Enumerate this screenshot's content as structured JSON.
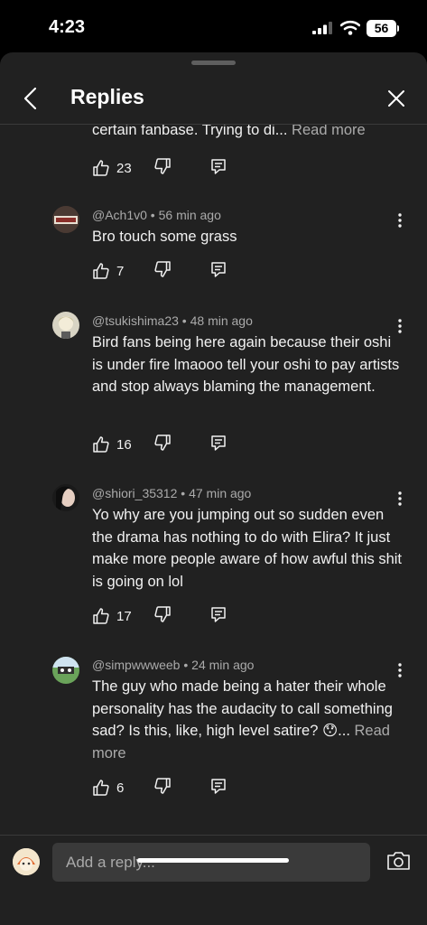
{
  "status_bar": {
    "time": "4:23",
    "battery": "56"
  },
  "header": {
    "title": "Replies"
  },
  "partial_comment": {
    "text": "certain fanbase. Trying to di...",
    "read_more": "Read more",
    "likes": "23"
  },
  "comments": [
    {
      "handle": "@Ach1v0",
      "time": "56 min ago",
      "text": "Bro touch some grass",
      "read_more": "",
      "likes": "7"
    },
    {
      "handle": "@tsukishima23",
      "time": "48 min ago",
      "text": "Bird fans being here again because their oshi is under fire lmaooo tell your oshi to pay artists and stop always blaming the management.",
      "read_more": "",
      "likes": "16"
    },
    {
      "handle": "@shiori_35312",
      "time": "47 min ago",
      "text": "Yo why are you jumping out so sudden even the drama has nothing to do with Elira? It just make more people aware of how awful this shit is going on lol",
      "read_more": "",
      "likes": "17"
    },
    {
      "handle": "@simpwwweeb",
      "time": "24 min ago",
      "text": "The guy who made being a hater their whole personality has the audacity to call something sad? Is this, like, high level satire? 😯...",
      "read_more": "Read more",
      "likes": "6"
    }
  ],
  "footer": {
    "reply_placeholder": "Add a reply..."
  },
  "colors": {
    "sheet_bg": "#212121",
    "text": "#f1f1f1",
    "secondary": "#aaaaaa"
  },
  "icons": [
    "back-arrow",
    "close",
    "thumb-up",
    "thumb-down",
    "reply-comment",
    "more-vertical",
    "camera"
  ]
}
